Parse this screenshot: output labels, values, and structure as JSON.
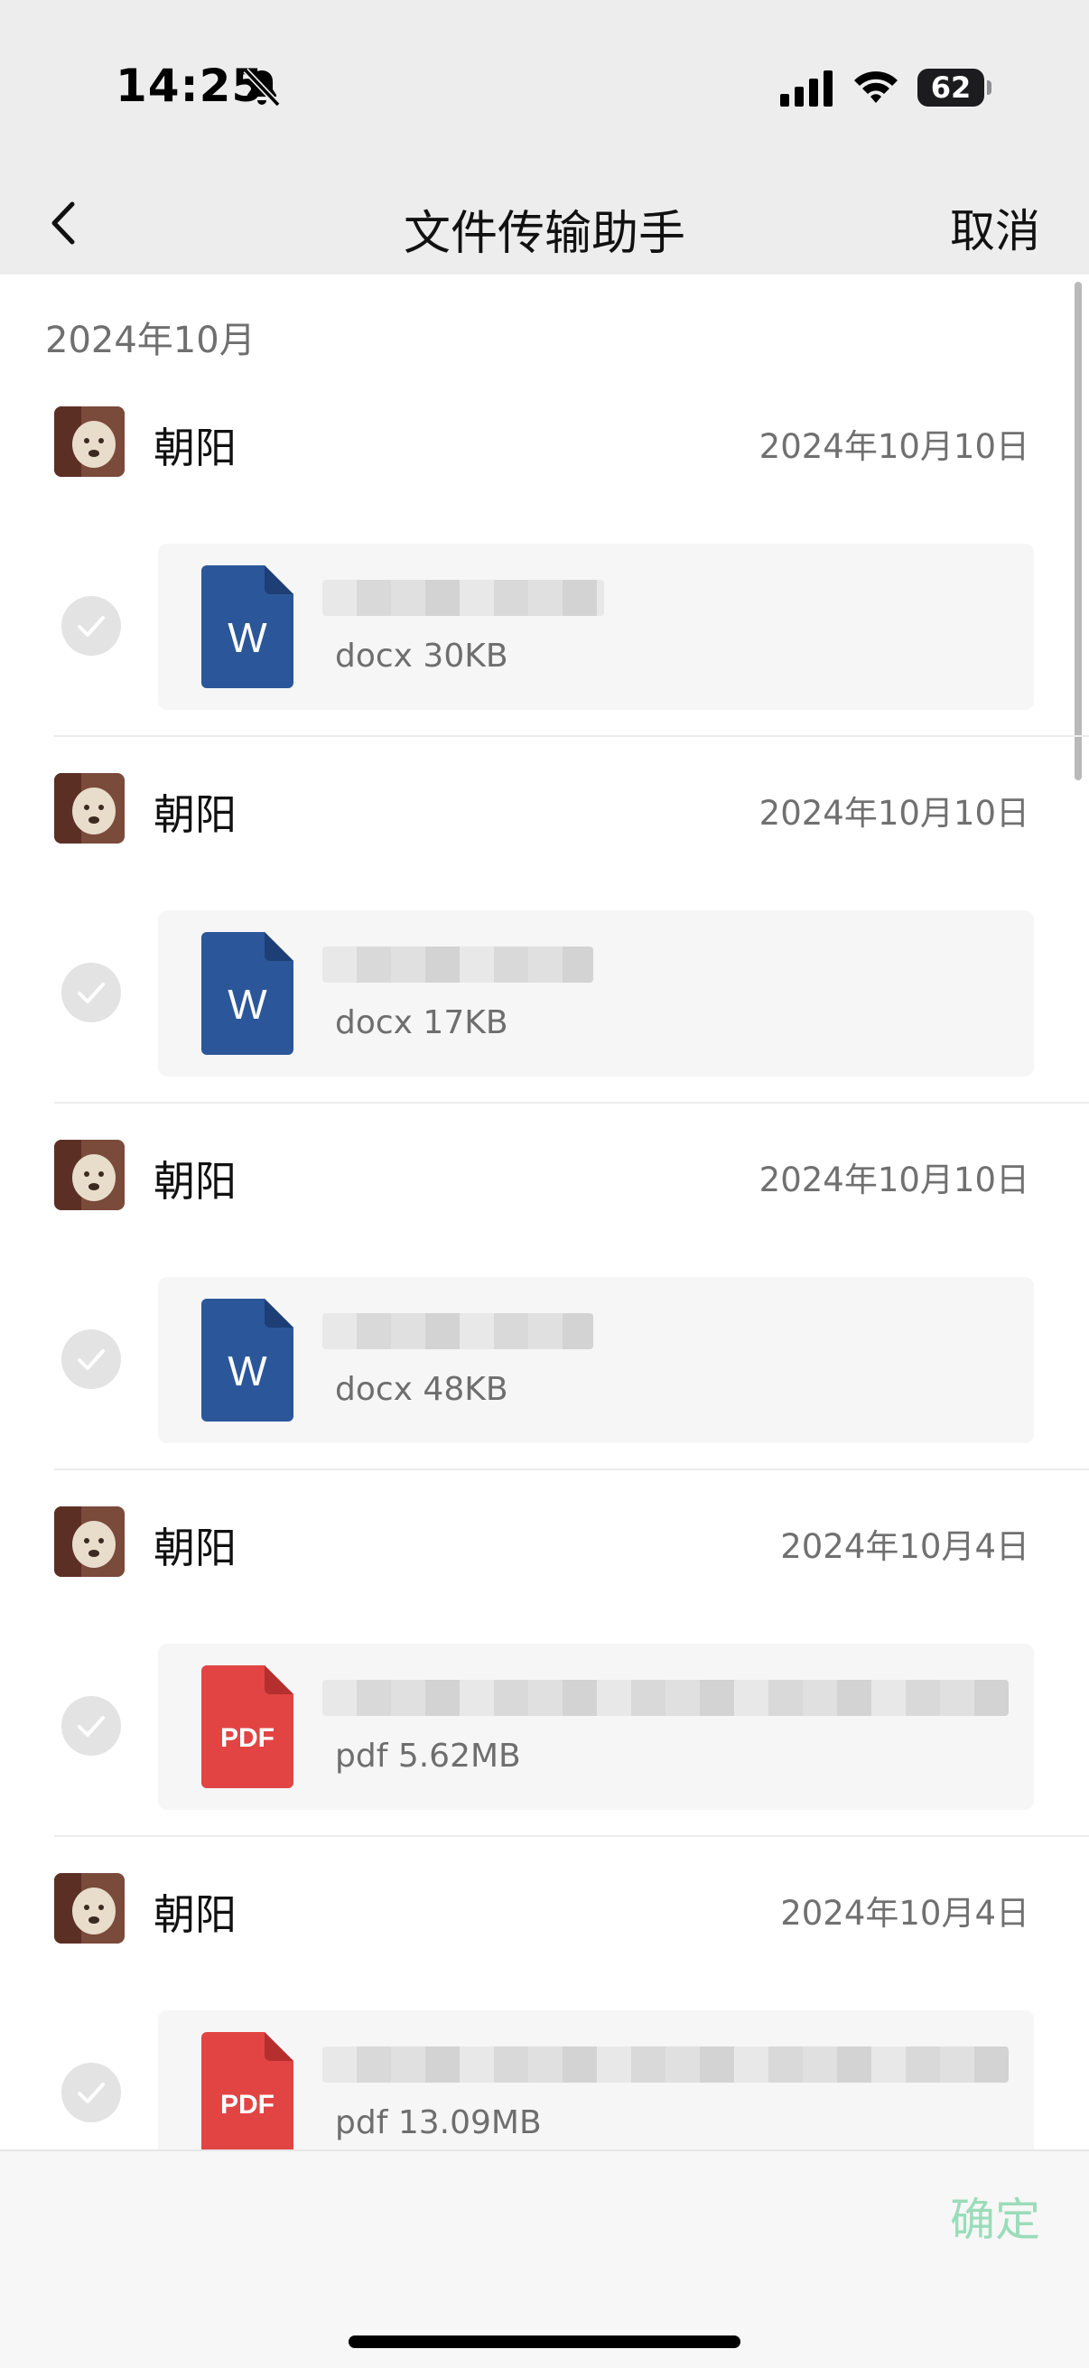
{
  "status_bar": {
    "time": "14:25",
    "battery": "62"
  },
  "nav": {
    "title": "文件传输助手",
    "cancel_label": "取消"
  },
  "month_header": "2024年10月",
  "entries": [
    {
      "sender": "朝阳",
      "date": "2024年10月10日",
      "file_type": "word",
      "file_icon_label": "W",
      "file_meta": "docx 30KB"
    },
    {
      "sender": "朝阳",
      "date": "2024年10月10日",
      "file_type": "word",
      "file_icon_label": "W",
      "file_meta": "docx 17KB"
    },
    {
      "sender": "朝阳",
      "date": "2024年10月10日",
      "file_type": "word",
      "file_icon_label": "W",
      "file_meta": "docx 48KB"
    },
    {
      "sender": "朝阳",
      "date": "2024年10月4日",
      "file_type": "pdf",
      "file_icon_label": "PDF",
      "file_meta": "pdf 5.62MB"
    },
    {
      "sender": "朝阳",
      "date": "2024年10月4日",
      "file_type": "pdf",
      "file_icon_label": "PDF",
      "file_meta": "pdf 13.09MB"
    }
  ],
  "bottom": {
    "confirm_label": "确定"
  },
  "colors": {
    "word_blue": "#2b579a",
    "pdf_red": "#e24444",
    "confirm_disabled": "#9bdcba"
  }
}
